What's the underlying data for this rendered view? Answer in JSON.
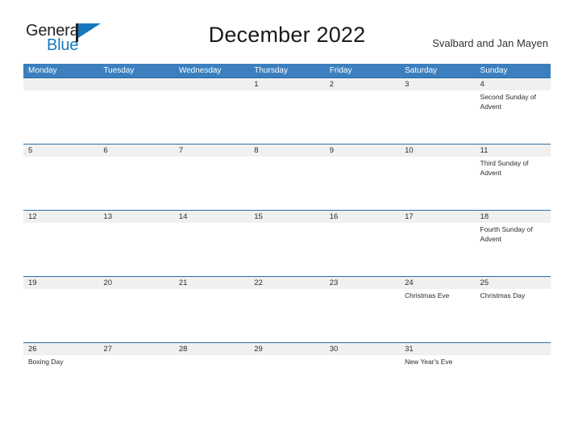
{
  "brand": {
    "name_part1": "General",
    "name_part2": "Blue",
    "primary_color": "#1878bd"
  },
  "header": {
    "title": "December 2022",
    "subtitle": "Svalbard and Jan Mayen"
  },
  "calendar": {
    "header_color": "#3b7fbf",
    "row_border_color": "#2e6da4",
    "date_band_color": "#f0f0f0",
    "weekdays": [
      "Monday",
      "Tuesday",
      "Wednesday",
      "Thursday",
      "Friday",
      "Saturday",
      "Sunday"
    ],
    "weeks": [
      {
        "days": [
          {
            "date": "",
            "event": ""
          },
          {
            "date": "",
            "event": ""
          },
          {
            "date": "",
            "event": ""
          },
          {
            "date": "1",
            "event": ""
          },
          {
            "date": "2",
            "event": ""
          },
          {
            "date": "3",
            "event": ""
          },
          {
            "date": "4",
            "event": "Second Sunday of Advent"
          }
        ]
      },
      {
        "days": [
          {
            "date": "5",
            "event": ""
          },
          {
            "date": "6",
            "event": ""
          },
          {
            "date": "7",
            "event": ""
          },
          {
            "date": "8",
            "event": ""
          },
          {
            "date": "9",
            "event": ""
          },
          {
            "date": "10",
            "event": ""
          },
          {
            "date": "11",
            "event": "Third Sunday of Advent"
          }
        ]
      },
      {
        "days": [
          {
            "date": "12",
            "event": ""
          },
          {
            "date": "13",
            "event": ""
          },
          {
            "date": "14",
            "event": ""
          },
          {
            "date": "15",
            "event": ""
          },
          {
            "date": "16",
            "event": ""
          },
          {
            "date": "17",
            "event": ""
          },
          {
            "date": "18",
            "event": "Fourth Sunday of Advent"
          }
        ]
      },
      {
        "days": [
          {
            "date": "19",
            "event": ""
          },
          {
            "date": "20",
            "event": ""
          },
          {
            "date": "21",
            "event": ""
          },
          {
            "date": "22",
            "event": ""
          },
          {
            "date": "23",
            "event": ""
          },
          {
            "date": "24",
            "event": "Christmas Eve"
          },
          {
            "date": "25",
            "event": "Christmas Day"
          }
        ]
      },
      {
        "days": [
          {
            "date": "26",
            "event": "Boxing Day"
          },
          {
            "date": "27",
            "event": ""
          },
          {
            "date": "28",
            "event": ""
          },
          {
            "date": "29",
            "event": ""
          },
          {
            "date": "30",
            "event": ""
          },
          {
            "date": "31",
            "event": "New Year's Eve"
          },
          {
            "date": "",
            "event": ""
          }
        ]
      }
    ]
  }
}
